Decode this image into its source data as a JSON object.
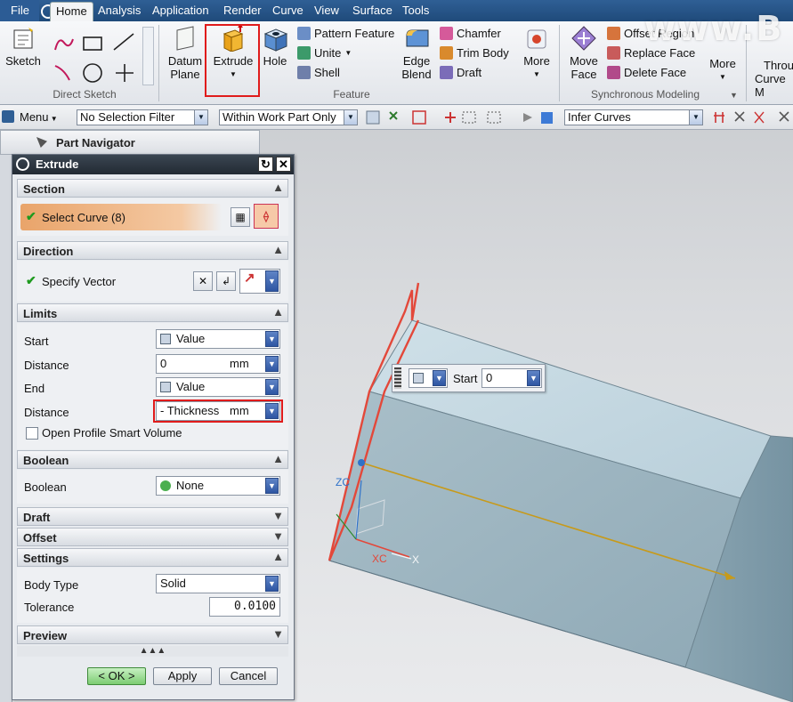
{
  "menubar": {
    "file": "File",
    "tabs": [
      "Home",
      "Analysis",
      "Application",
      "Render",
      "Curve",
      "View",
      "Surface",
      "Tools"
    ]
  },
  "watermark": "www.B",
  "ribbon": {
    "sketch": "Sketch",
    "direct_sketch_label": "Direct Sketch",
    "datum_plane": [
      "Datum",
      "Plane"
    ],
    "extrude": "Extrude",
    "hole": "Hole",
    "pattern_feature": "Pattern Feature",
    "unite": "Unite",
    "shell": "Shell",
    "edge_blend": [
      "Edge",
      "Blend"
    ],
    "chamfer": "Chamfer",
    "trim_body": "Trim Body",
    "draft": "Draft",
    "more1": "More",
    "feature_label": "Feature",
    "move_face": [
      "Move",
      "Face"
    ],
    "offset_region": "Offset Region",
    "replace_face": "Replace Face",
    "delete_face": "Delete Face",
    "more2": "More",
    "sync_label": "Synchronous Modeling",
    "through_curve": [
      "Throu",
      "Curve M"
    ]
  },
  "toolbar": {
    "menu": "Menu",
    "selection_filter": "No Selection Filter",
    "scope": "Within Work Part Only",
    "curve_rule": "Infer Curves"
  },
  "navigator": {
    "title": "Part Navigator"
  },
  "dialog": {
    "title": "Extrude",
    "section": "Section",
    "select_curve": "Select Curve (8)",
    "direction": "Direction",
    "specify_vector": "Specify Vector",
    "limits": "Limits",
    "start_label": "Start",
    "start_value": "Value",
    "distance_label": "Distance",
    "start_distance": "0",
    "unit": "mm",
    "end_label": "End",
    "end_value": "Value",
    "end_distance": "- Thickness",
    "open_profile": "Open Profile Smart Volume",
    "boolean": "Boolean",
    "boolean_label": "Boolean",
    "boolean_value": "None",
    "draft": "Draft",
    "offset": "Offset",
    "settings": "Settings",
    "body_type_label": "Body Type",
    "body_type_value": "Solid",
    "tolerance_label": "Tolerance",
    "tolerance_value": "0.0100",
    "preview": "Preview",
    "ok": "< OK >",
    "apply": "Apply",
    "cancel": "Cancel"
  },
  "viewport": {
    "start_label": "Start",
    "start_value": "0",
    "axis_zc": "ZC",
    "axis_xc": "XC",
    "axis_x": "X"
  },
  "colors": {
    "highlight": "#e01b1b",
    "accent": "#2e56a3"
  }
}
